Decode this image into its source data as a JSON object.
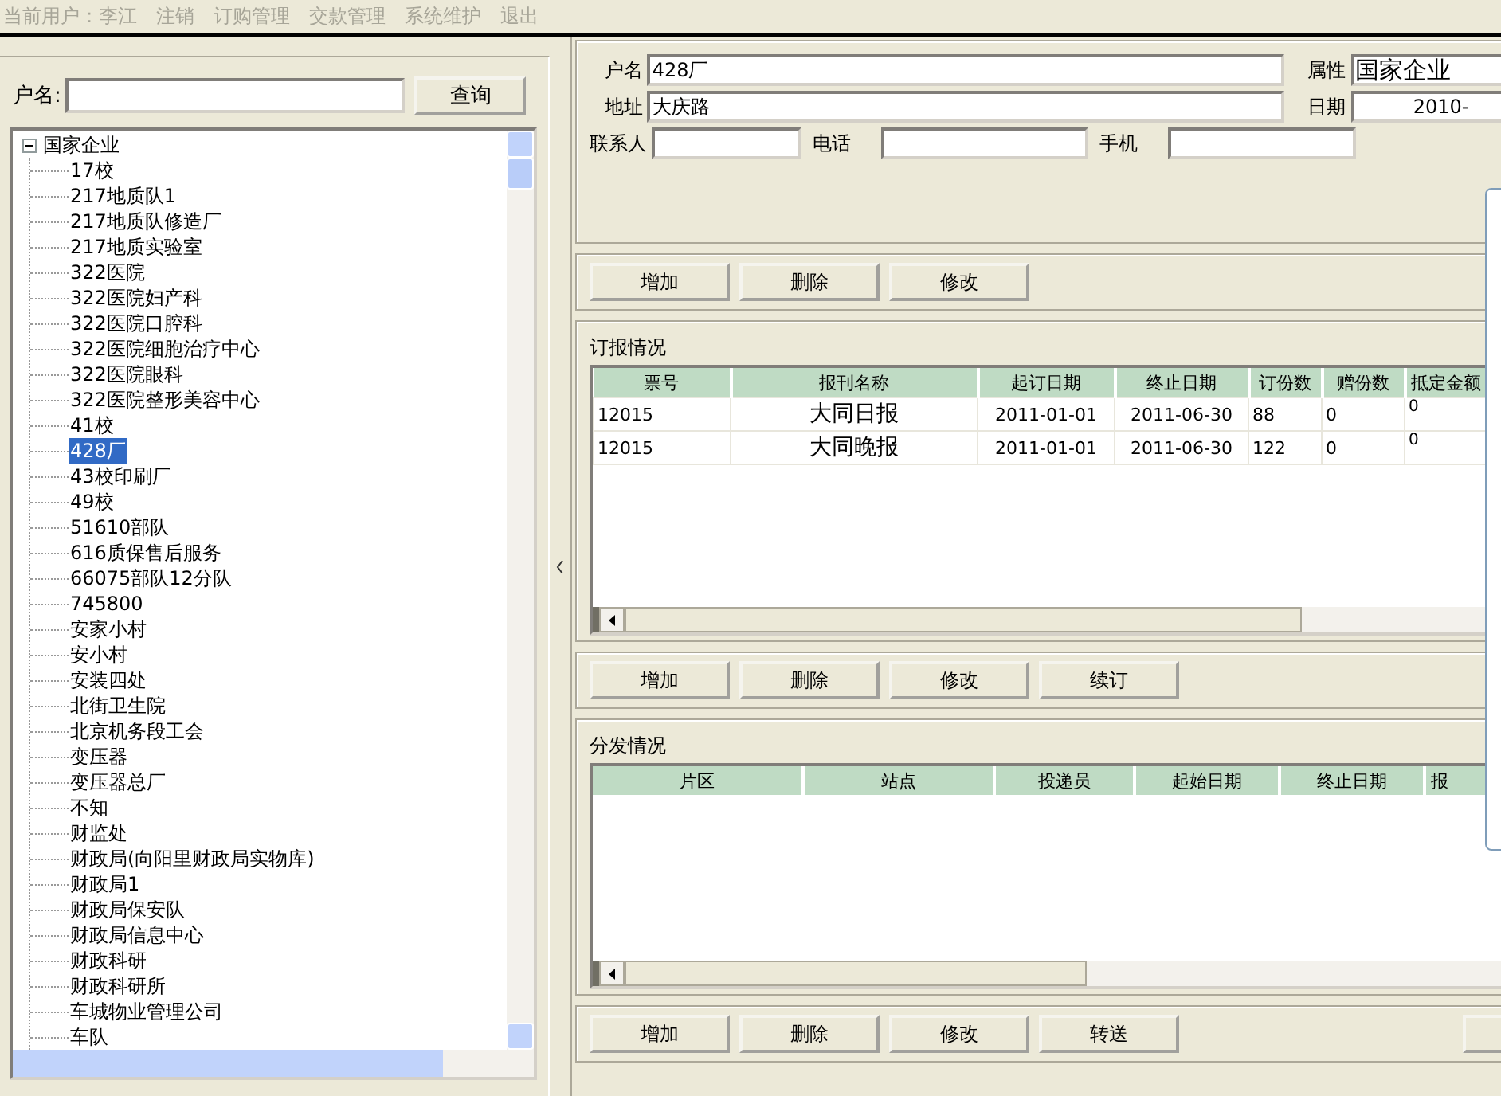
{
  "menu_bar": {
    "user_label": "当前用户：李江",
    "items": [
      {
        "label": "注销",
        "disabled": true
      },
      {
        "label": "订购管理",
        "disabled": true
      },
      {
        "label": "交款管理",
        "disabled": true
      },
      {
        "label": "系统维护",
        "disabled": true
      },
      {
        "label": "退出",
        "disabled": true
      }
    ]
  },
  "search": {
    "label": "户名:",
    "button": "查询"
  },
  "tree": {
    "label": "国家企业",
    "expanded": true,
    "children": [
      {
        "label": "17校",
        "selected": false
      },
      {
        "label": "217地质队1",
        "selected": false
      },
      {
        "label": "217地质队修造厂",
        "selected": false
      },
      {
        "label": "217地质实验室",
        "selected": false
      },
      {
        "label": "322医院",
        "selected": false
      },
      {
        "label": "322医院妇产科",
        "selected": false
      },
      {
        "label": "322医院口腔科",
        "selected": false
      },
      {
        "label": "322医院细胞治疗中心",
        "selected": false
      },
      {
        "label": "322医院眼科",
        "selected": false
      },
      {
        "label": "322医院整形美容中心",
        "selected": false
      },
      {
        "label": "41校",
        "selected": false
      },
      {
        "label": "428厂",
        "selected": true
      },
      {
        "label": "43校印刷厂",
        "selected": false
      },
      {
        "label": "49校",
        "selected": false
      },
      {
        "label": "51610部队",
        "selected": false
      },
      {
        "label": "616质保售后服务",
        "selected": false
      },
      {
        "label": "66075部队12分队",
        "selected": false
      },
      {
        "label": "745800",
        "selected": false
      },
      {
        "label": "安家小村",
        "selected": false
      },
      {
        "label": "安小村",
        "selected": false
      },
      {
        "label": "安装四处",
        "selected": false
      },
      {
        "label": "北街卫生院",
        "selected": false
      },
      {
        "label": "北京机务段工会",
        "selected": false
      },
      {
        "label": "变压器",
        "selected": false
      },
      {
        "label": "变压器总厂",
        "selected": false
      },
      {
        "label": "不知",
        "selected": false
      },
      {
        "label": "财监处",
        "selected": false
      },
      {
        "label": "财政局(向阳里财政局实物库)",
        "selected": false
      },
      {
        "label": "财政局1",
        "selected": false
      },
      {
        "label": "财政局保安队",
        "selected": false
      },
      {
        "label": "财政局信息中心",
        "selected": false
      },
      {
        "label": "财政科研",
        "selected": false
      },
      {
        "label": "财政科研所",
        "selected": false
      },
      {
        "label": "车城物业管理公司",
        "selected": false
      },
      {
        "label": "车队",
        "selected": false
      }
    ]
  },
  "customer": {
    "name_label": "户名",
    "name": "428厂",
    "address_label": "地址",
    "address": "大庆路",
    "type_label": "属性",
    "type": "国家企业",
    "date_label": "日期",
    "date": "2010-",
    "contact_label": "联系人",
    "phone_label": "电话",
    "mobile_label": "手机"
  },
  "customer_buttons": [
    "增加",
    "删除",
    "修改"
  ],
  "subscriptions": {
    "title": "订报情况",
    "columns": [
      "票号",
      "报刊名称",
      "起订日期",
      "终止日期",
      "订份数",
      "赠份数",
      "抵定金额"
    ],
    "rows": [
      [
        "12015",
        "大同日报",
        "2011-01-01",
        "2011-06-30",
        "88",
        "0",
        "0"
      ],
      [
        "12015",
        "大同晚报",
        "2011-01-01",
        "2011-06-30",
        "122",
        "0",
        "0"
      ]
    ]
  },
  "subscription_buttons": [
    "增加",
    "删除",
    "修改",
    "续订"
  ],
  "distribution": {
    "title": "分发情况",
    "columns": [
      "片区",
      "站点",
      "投递员",
      "起始日期",
      "终止日期",
      "报"
    ]
  },
  "distribution_buttons": [
    "增加",
    "删除",
    "修改",
    "转送"
  ]
}
